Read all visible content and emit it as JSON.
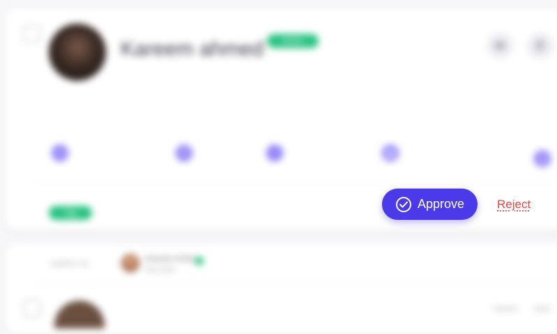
{
  "candidate": {
    "name": "Kareem ahmed",
    "status_badge": "Active"
  },
  "header_actions": [
    {
      "icon": "mail-icon",
      "glyph": "✉"
    },
    {
      "icon": "phone-icon",
      "glyph": "✆"
    }
  ],
  "info_icons": [
    {
      "icon": "clock-icon",
      "glyph": "◷"
    },
    {
      "icon": "location-icon",
      "glyph": "▼"
    },
    {
      "icon": "check-icon",
      "glyph": "✓"
    },
    {
      "icon": "calendar-icon",
      "glyph": "▦"
    },
    {
      "icon": "arrow-icon",
      "glyph": "❯"
    }
  ],
  "tag_pill": "Tag",
  "actions": {
    "approve_label": "Approve",
    "reject_label": "Reject"
  },
  "second_card": {
    "label": "Applied via",
    "person_name": "Hossam Anbar",
    "person_role": "Recruiter",
    "right_items": [
      "Details",
      "More"
    ]
  },
  "colors": {
    "accent": "#4b3ae9",
    "success": "#27c281",
    "danger": "#e64545",
    "icon": "#8d7ff5"
  }
}
